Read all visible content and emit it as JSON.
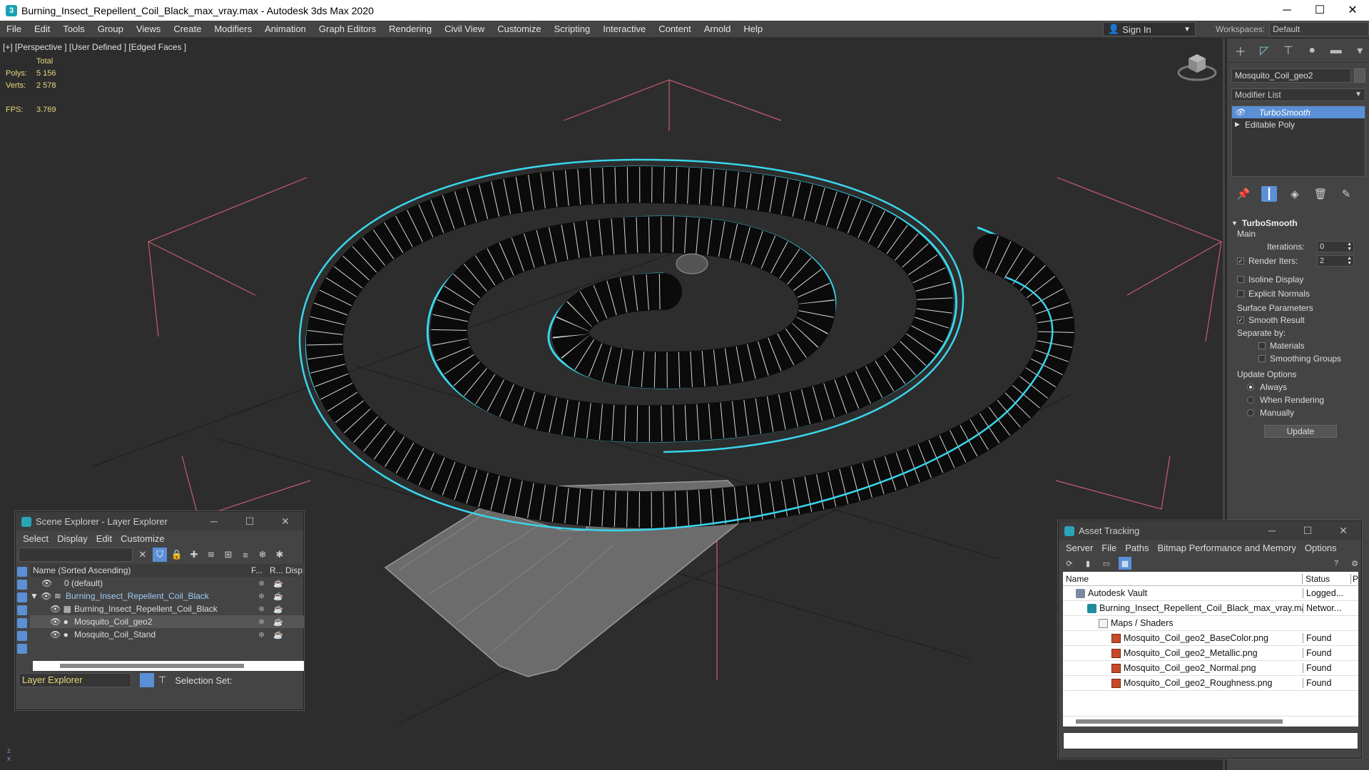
{
  "window": {
    "title": "Burning_Insect_Repellent_Coil_Black_max_vray.max - Autodesk 3ds Max 2020",
    "minimize": "─",
    "maximize": "☐",
    "close": "✕"
  },
  "menu": [
    "File",
    "Edit",
    "Tools",
    "Group",
    "Views",
    "Create",
    "Modifiers",
    "Animation",
    "Graph Editors",
    "Rendering",
    "Civil View",
    "Customize",
    "Scripting",
    "Interactive",
    "Content",
    "Arnold",
    "Help"
  ],
  "signin": {
    "label": "Sign In"
  },
  "workspaces": {
    "label": "Workspaces:",
    "value": "Default"
  },
  "viewport": {
    "label": "[+] [Perspective ] [User Defined ] [Edged Faces ]",
    "stats": {
      "total": "Total",
      "polys_label": "Polys:",
      "polys": "5 156",
      "verts_label": "Verts:",
      "verts": "2 578",
      "fps_label": "FPS:",
      "fps": "3.769"
    }
  },
  "command_panel": {
    "object_name": "Mosquito_Coil_geo2",
    "modifier_list": "Modifier List",
    "stack": [
      {
        "label": "TurboSmooth",
        "selected": true
      },
      {
        "label": "Editable Poly",
        "selected": false
      }
    ],
    "turbosmooth": {
      "title": "TurboSmooth",
      "main": "Main",
      "iterations_label": "Iterations:",
      "iterations": "0",
      "render_iters_label": "Render Iters:",
      "render_iters": "2",
      "render_iters_checked": true,
      "isoline": "Isoline Display",
      "explicit_normals": "Explicit Normals",
      "surface_params": "Surface Parameters",
      "smooth_result": "Smooth Result",
      "separate_by": "Separate by:",
      "materials": "Materials",
      "smoothing_groups": "Smoothing Groups",
      "update_options": "Update Options",
      "always": "Always",
      "when_rendering": "When Rendering",
      "manually": "Manually",
      "update": "Update"
    }
  },
  "scene_explorer": {
    "title": "Scene Explorer - Layer Explorer",
    "menu": [
      "Select",
      "Display",
      "Edit",
      "Customize"
    ],
    "col_name": "Name (Sorted Ascending)",
    "col_f": "F...",
    "col_r": "R...",
    "col_disp": "Disp",
    "rows": [
      {
        "label": "0 (default)",
        "indent": 1,
        "highlight": false
      },
      {
        "label": "Burning_Insect_Repellent_Coil_Black",
        "indent": 0,
        "highlight": false
      },
      {
        "label": "Burning_Insect_Repellent_Coil_Black",
        "indent": 2,
        "highlight": false
      },
      {
        "label": "Mosquito_Coil_geo2",
        "indent": 2,
        "highlight": true
      },
      {
        "label": "Mosquito_Coil_Stand",
        "indent": 2,
        "highlight": false
      }
    ],
    "footer_label": "Layer Explorer",
    "selection_set": "Selection Set:"
  },
  "asset_tracking": {
    "title": "Asset Tracking",
    "menu": [
      "Server",
      "File",
      "Paths",
      "Bitmap Performance and Memory",
      "Options"
    ],
    "col_name": "Name",
    "col_status": "Status",
    "col_p": "P",
    "rows": [
      {
        "name": "Autodesk Vault",
        "status": "Logged...",
        "icon": "vault",
        "indent": 1
      },
      {
        "name": "Burning_Insect_Repellent_Coil_Black_max_vray.max",
        "status": "Networ...",
        "icon": "max",
        "indent": 2
      },
      {
        "name": "Maps / Shaders",
        "status": "",
        "icon": "folder",
        "indent": 3
      },
      {
        "name": "Mosquito_Coil_geo2_BaseColor.png",
        "status": "Found",
        "icon": "png",
        "indent": 4
      },
      {
        "name": "Mosquito_Coil_geo2_Metallic.png",
        "status": "Found",
        "icon": "png",
        "indent": 4
      },
      {
        "name": "Mosquito_Coil_geo2_Normal.png",
        "status": "Found",
        "icon": "png",
        "indent": 4
      },
      {
        "name": "Mosquito_Coil_geo2_Roughness.png",
        "status": "Found",
        "icon": "png",
        "indent": 4
      }
    ]
  },
  "colors": {
    "accent": "#5b8fd6",
    "selection_cyan": "#39d6ec",
    "stats_yellow": "#e8d97a",
    "grid_pink": "#c85a73"
  }
}
